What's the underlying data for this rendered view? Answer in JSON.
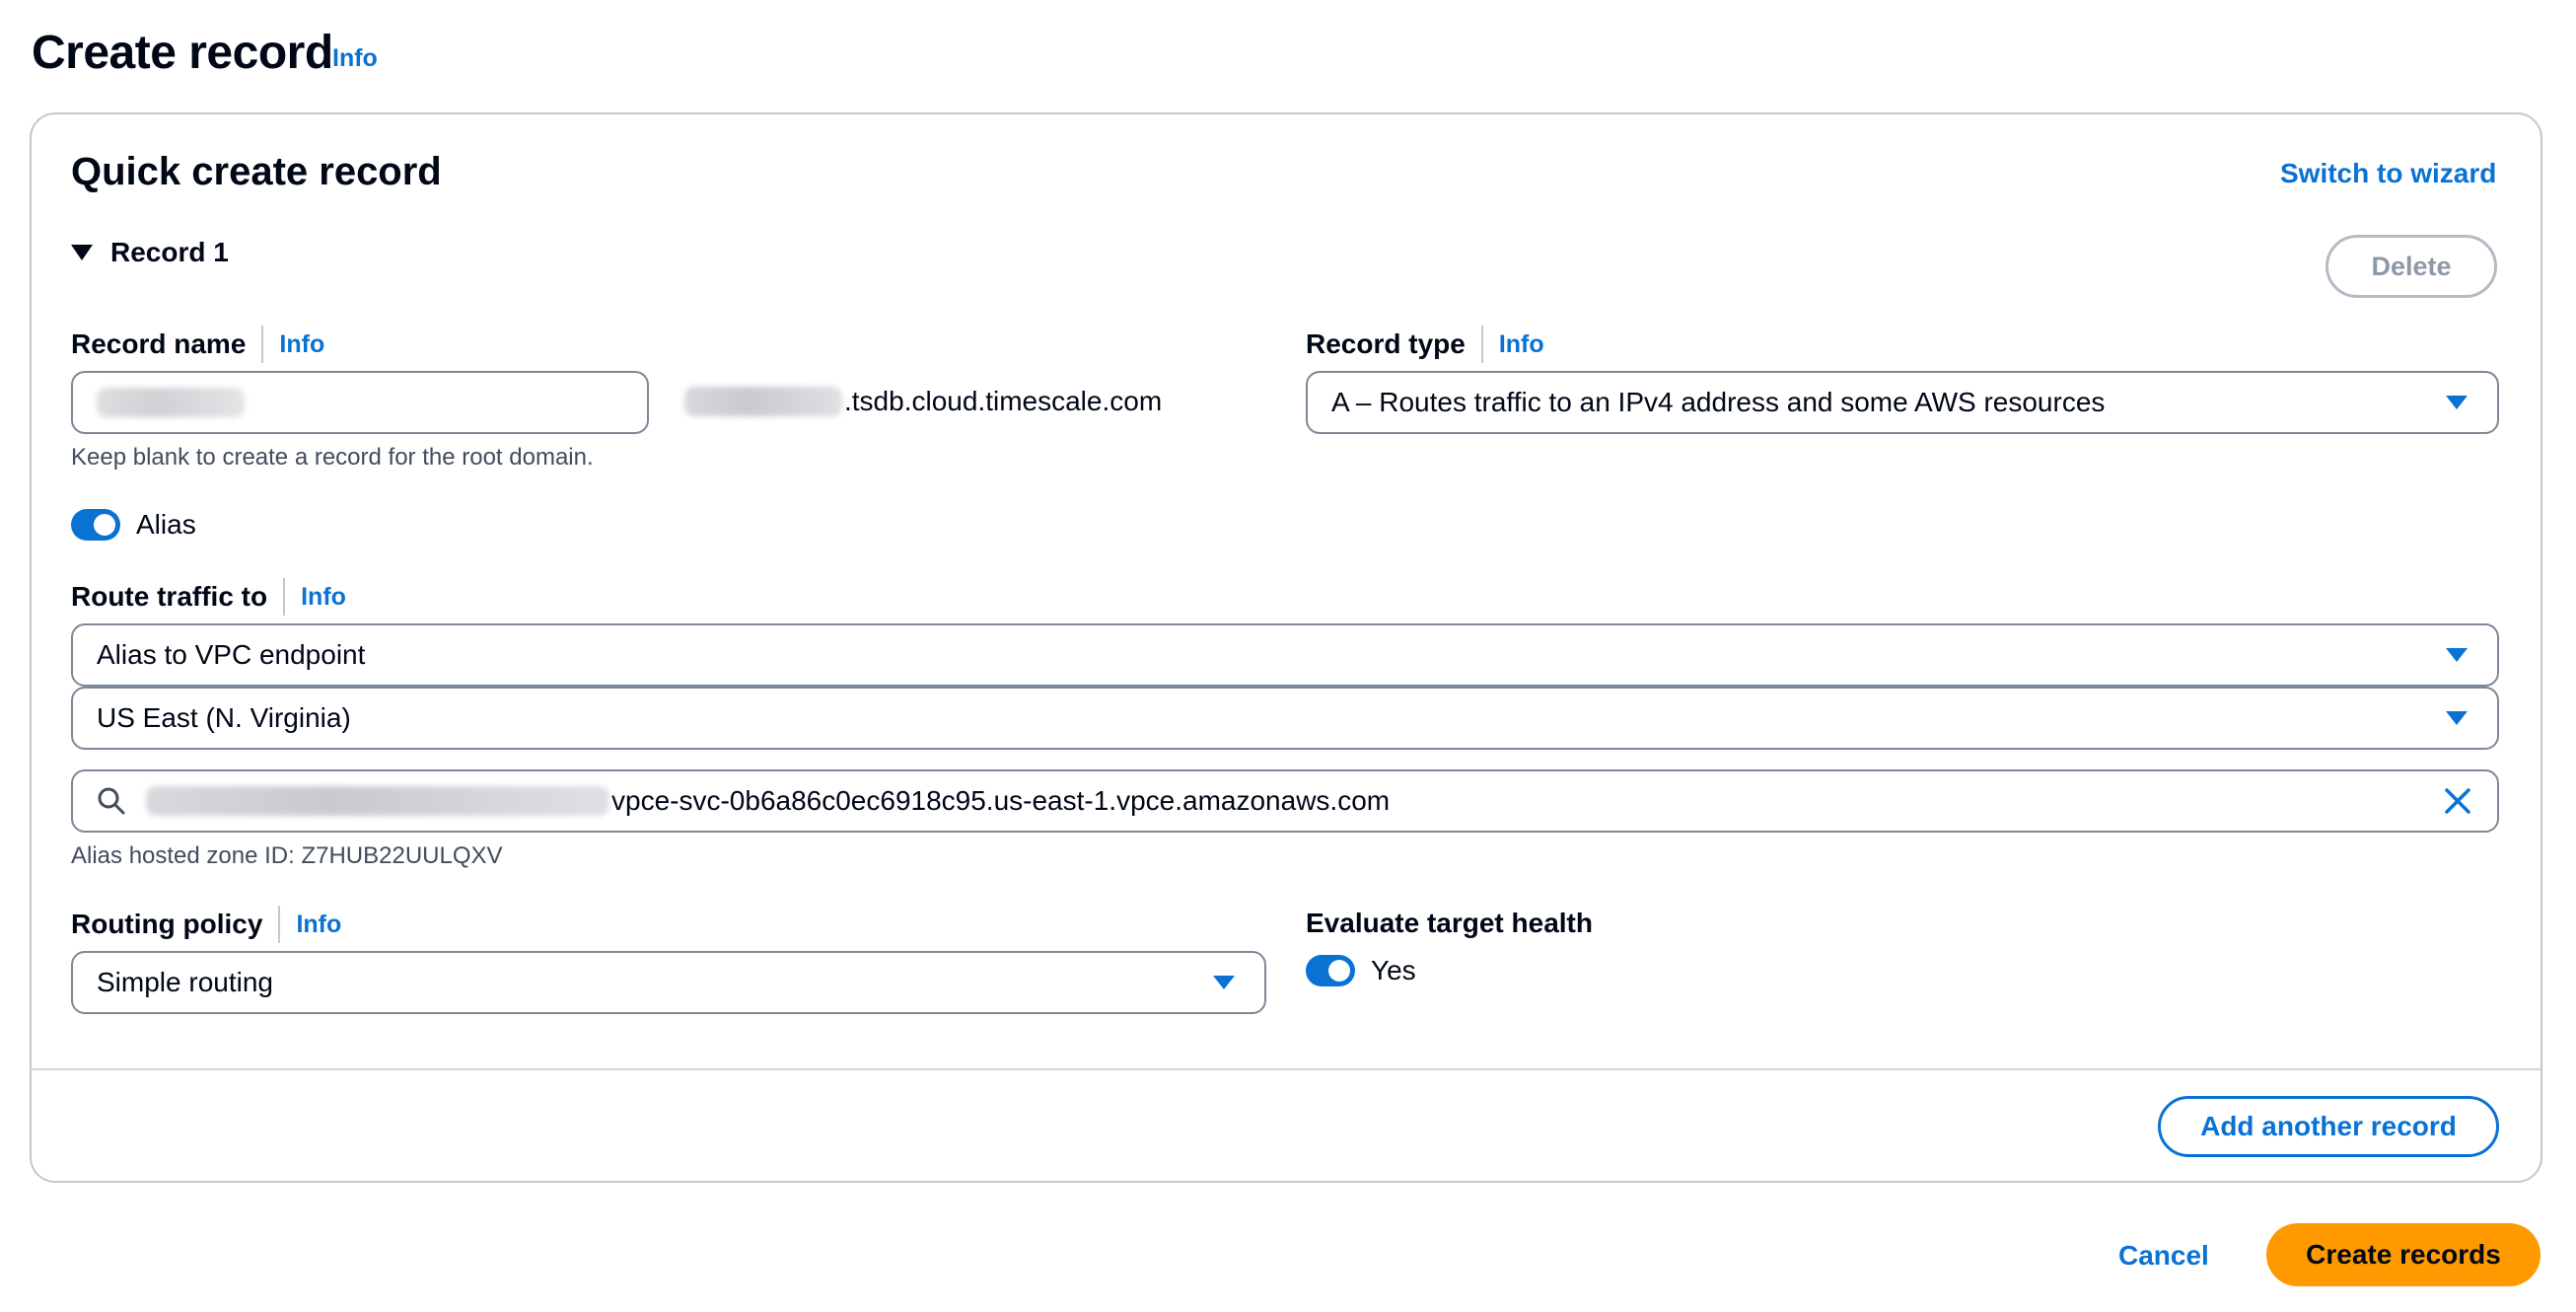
{
  "header": {
    "title": "Create record",
    "info_label": "Info"
  },
  "panel": {
    "title": "Quick create record",
    "switch_label": "Switch to wizard",
    "record_label": "Record 1",
    "delete_label": "Delete"
  },
  "record_name": {
    "label": "Record name",
    "info_label": "Info",
    "domain_suffix": ".tsdb.cloud.timescale.com",
    "hint": "Keep blank to create a record for the root domain."
  },
  "record_type": {
    "label": "Record type",
    "info_label": "Info",
    "value": "A – Routes traffic to an IPv4 address and some AWS resources"
  },
  "alias": {
    "label": "Alias",
    "enabled": true
  },
  "route_traffic": {
    "label": "Route traffic to",
    "info_label": "Info",
    "endpoint_value": "Alias to VPC endpoint",
    "region_value": "US East (N. Virginia)",
    "search_value": "vpce-svc-0b6a86c0ec6918c95.us-east-1.vpce.amazonaws.com",
    "hosted_zone": "Alias hosted zone ID: Z7HUB22UULQXV"
  },
  "routing_policy": {
    "label": "Routing policy",
    "info_label": "Info",
    "value": "Simple routing"
  },
  "evaluate_health": {
    "label": "Evaluate target health",
    "toggle_label": "Yes",
    "enabled": true
  },
  "footer": {
    "add_label": "Add another record",
    "cancel_label": "Cancel",
    "create_label": "Create records"
  },
  "colors": {
    "accent": "#0972d3",
    "primary_button": "#ff9900",
    "border": "#7d8998"
  }
}
